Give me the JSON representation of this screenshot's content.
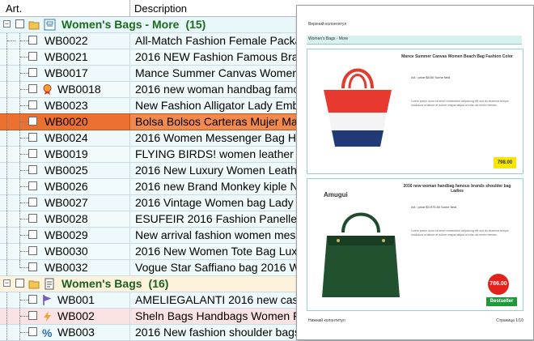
{
  "header": {
    "col_art": "Art.",
    "col_desc": "Description"
  },
  "groups": [
    {
      "title": "Women's Bags - More",
      "count": "(15)"
    },
    {
      "title": "Women's Bags",
      "count": "(16)"
    }
  ],
  "rows": [
    {
      "art": "WB0022",
      "desc": "All-Match Fashion Female Package"
    },
    {
      "art": "WB0021",
      "desc": "2016 NEW Fashion Famous Brand"
    },
    {
      "art": "WB0017",
      "desc": "Mance Summer Canvas Women B"
    },
    {
      "art": "WB0018",
      "desc": "2016 new woman handbag famous"
    },
    {
      "art": "WB0023",
      "desc": "New Fashion Alligator Lady Embos"
    },
    {
      "art": "WB0020",
      "desc": "Bolsa Bolsos Carteras Mujer Marc"
    },
    {
      "art": "WB0024",
      "desc": "2016 Women Messenger Bag Hollo"
    },
    {
      "art": "WB0019",
      "desc": "FLYING BIRDS! women leather han"
    },
    {
      "art": "WB0025",
      "desc": "2016 New Luxury Women Leather"
    },
    {
      "art": "WB0026",
      "desc": "2016 new Brand Monkey kiple Nylo"
    },
    {
      "art": "WB0027",
      "desc": "2016 Vintage Women bag Lady PU"
    },
    {
      "art": "WB0028",
      "desc": "ESUFEIR 2016 Fashion Panelled Lu"
    },
    {
      "art": "WB0029",
      "desc": "New arrival fashion women messen"
    },
    {
      "art": "WB0030",
      "desc": "2016 New Women Tote Bag Luxury"
    },
    {
      "art": "WB0032",
      "desc": "Vogue Star Saffiano bag 2016 Women"
    },
    {
      "art": "WB001",
      "desc": "AMELIEGALANTI 2016 new casua"
    },
    {
      "art": "WB002",
      "desc": "Sheln Bags Handbags Women Fa"
    },
    {
      "art": "WB003",
      "desc": "2016 New fashion shoulder bags ha"
    }
  ],
  "preview": {
    "header_text": "Верхний колонтитул",
    "band_text": "Women's Bags - More",
    "card1_title": "Mance Summer Canvas Women Beach Bag Fashion Color",
    "card1_art": "Art.: price:$8,50 Some field",
    "card1_price": "798.00",
    "card2_title": "2016 new woman handbag famous brands shoulder bag Ladies",
    "card2_art": "Art.: price:$3,975.50 Some field",
    "card2_brand": "Amugui",
    "card2_price": "786.00",
    "card2_badge": "Bestseller",
    "lorem": "Lorem ipsum dolor sit amet consectetur adipiscing elit sed do eiusmod tempor incididunt ut labore et dolore magna aliqua ut enim ad minim veniam.",
    "footer_left": "Нижний колонтитул",
    "footer_right": "Страница 1/10"
  },
  "colors": {
    "selected_row": "#ec7131",
    "group_text": "#1a6b1a",
    "price_badge": "#f6e600",
    "bestseller": "#1e9a3b"
  }
}
